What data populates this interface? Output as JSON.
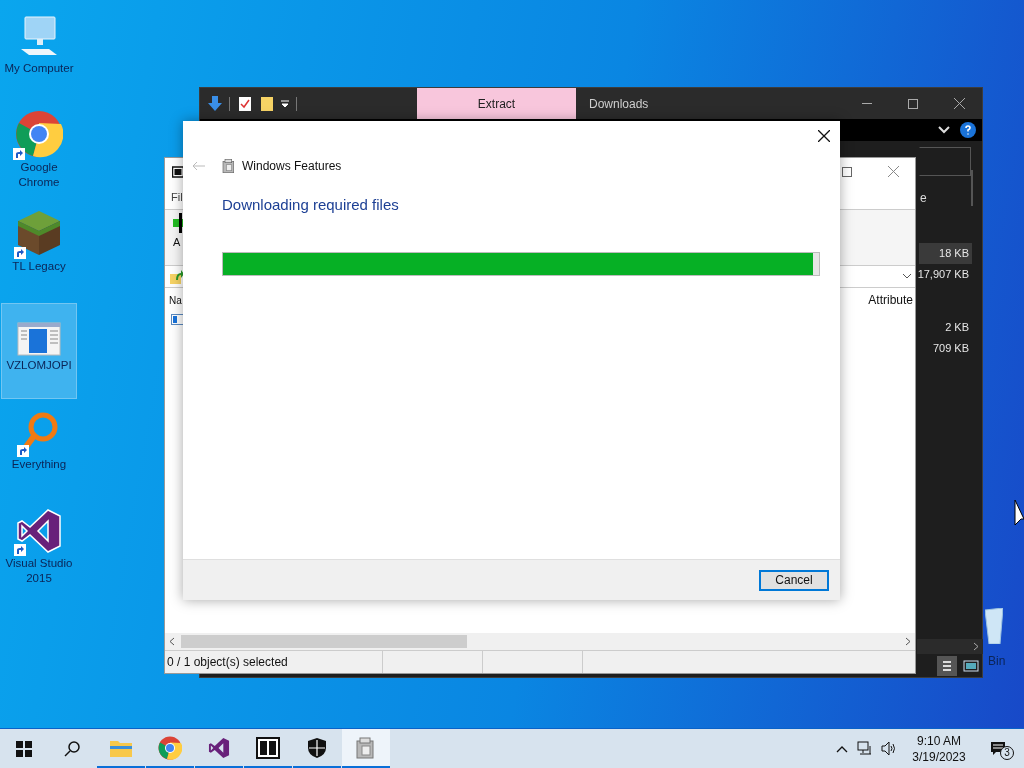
{
  "desktop_icons": [
    {
      "kind": "computer",
      "label": "My Computer",
      "shortcut": false,
      "selected": false
    },
    {
      "kind": "chrome",
      "label": "Google Chrome",
      "shortcut": true,
      "selected": false
    },
    {
      "kind": "grass",
      "label": "TL Legacy",
      "shortcut": true,
      "selected": false
    },
    {
      "kind": "app",
      "label": "VZLOMJOPI",
      "shortcut": false,
      "selected": true
    },
    {
      "kind": "magnifier",
      "label": "Everything",
      "shortcut": true,
      "selected": false
    },
    {
      "kind": "vs",
      "label": "Visual Studio 2015",
      "shortcut": true,
      "selected": false
    }
  ],
  "recycle_bin": {
    "label": "Bin"
  },
  "explorer": {
    "tabs": [
      {
        "label": "Extract",
        "selected": true
      },
      {
        "label": "Downloads",
        "selected": false
      }
    ],
    "column_header": "e",
    "sizes": [
      {
        "text": "18 KB",
        "selected": true
      },
      {
        "text": "17,907 KB",
        "selected": false
      },
      {
        "text": "2 KB",
        "selected": false
      },
      {
        "text": "709 KB",
        "selected": false
      }
    ]
  },
  "archive_window": {
    "menu": "Fil",
    "toolbar_label": "A",
    "columns": [
      "Na",
      "Attribute"
    ],
    "status": "0 / 1 object(s) selected"
  },
  "dialog": {
    "title": "Windows Features",
    "heading": "Downloading required files",
    "progress": {
      "level": 0.99
    },
    "button": "Cancel"
  },
  "taskbar": {
    "apps": [
      {
        "kind": "explorer",
        "open": true,
        "selected": false
      },
      {
        "kind": "chrome",
        "open": true,
        "selected": false
      },
      {
        "kind": "vs",
        "open": true,
        "selected": false
      },
      {
        "kind": "archiver",
        "open": true,
        "selected": false
      },
      {
        "kind": "shield",
        "open": true,
        "selected": false
      },
      {
        "kind": "features",
        "open": true,
        "selected": true
      }
    ],
    "time": "9:10 AM",
    "date": "3/19/2023",
    "notifications": "3"
  }
}
